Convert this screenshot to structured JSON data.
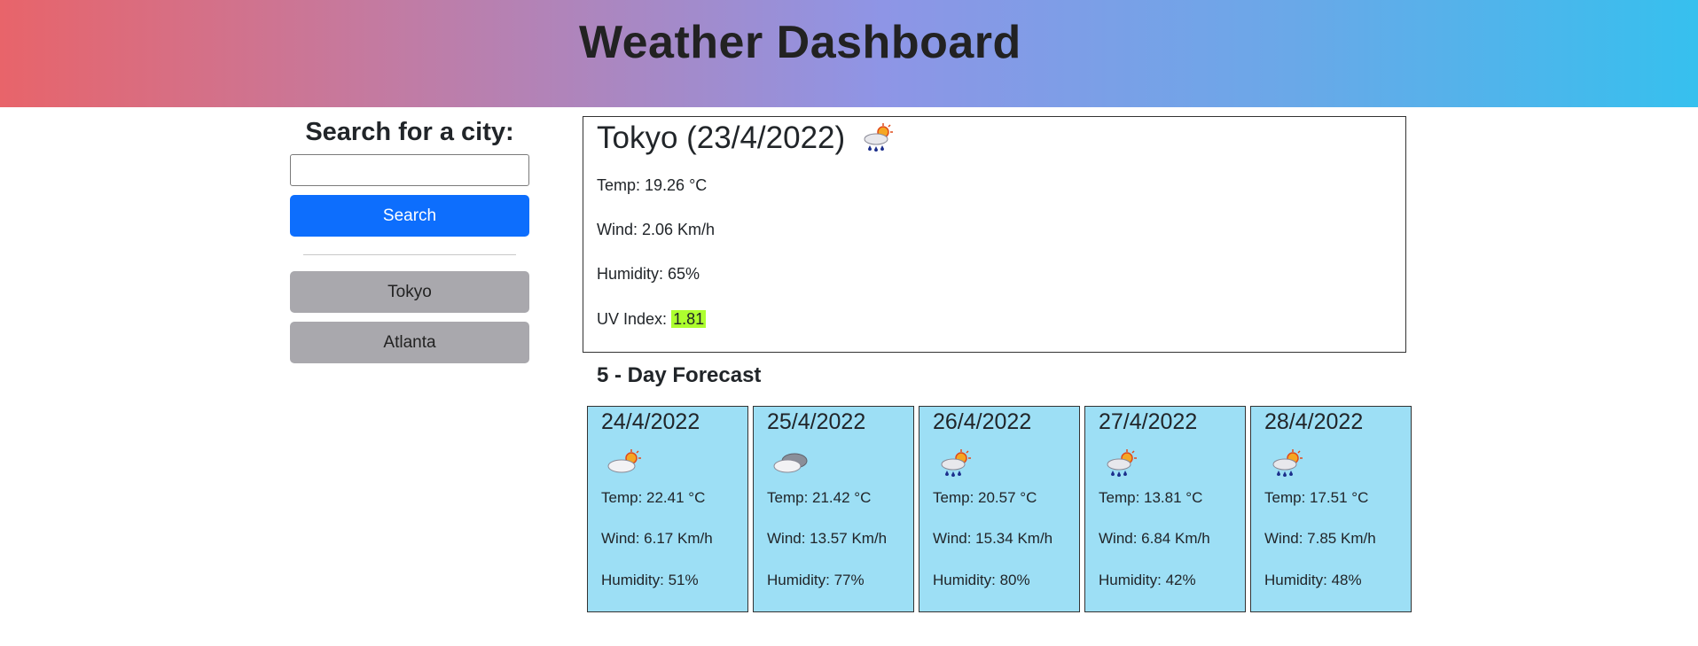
{
  "header": {
    "title": "Weather Dashboard"
  },
  "search": {
    "title": "Search for a city:",
    "input_value": "",
    "placeholder": "",
    "button_label": "Search"
  },
  "history": [
    "Tokyo",
    "Atlanta"
  ],
  "current": {
    "title": "Tokyo (23/4/2022)",
    "icon": "cloud-sun-rain-icon",
    "temp": "Temp: 19.26 °C",
    "wind": "Wind: 2.06 Km/h",
    "humidity": "Humidity: 65%",
    "uv_label": "UV Index:",
    "uv_value": "1.81",
    "uv_color": "#adff2f"
  },
  "forecast": {
    "heading": "5 - Day Forecast",
    "card_color": "#9ddff5",
    "days": [
      {
        "date": "24/4/2022",
        "icon": "cloud-sun-icon",
        "temp": "Temp: 22.41 °C",
        "wind": "Wind: 6.17 Km/h",
        "humidity": "Humidity: 51%"
      },
      {
        "date": "25/4/2022",
        "icon": "cloud-icon",
        "temp": "Temp: 21.42 °C",
        "wind": "Wind: 13.57 Km/h",
        "humidity": "Humidity: 77%"
      },
      {
        "date": "26/4/2022",
        "icon": "cloud-sun-rain-icon",
        "temp": "Temp: 20.57 °C",
        "wind": "Wind: 15.34 Km/h",
        "humidity": "Humidity: 80%"
      },
      {
        "date": "27/4/2022",
        "icon": "cloud-sun-rain-icon",
        "temp": "Temp: 13.81 °C",
        "wind": "Wind: 6.84 Km/h",
        "humidity": "Humidity: 42%"
      },
      {
        "date": "28/4/2022",
        "icon": "cloud-sun-rain-icon",
        "temp": "Temp: 17.51 °C",
        "wind": "Wind: 7.85 Km/h",
        "humidity": "Humidity: 48%"
      }
    ]
  }
}
